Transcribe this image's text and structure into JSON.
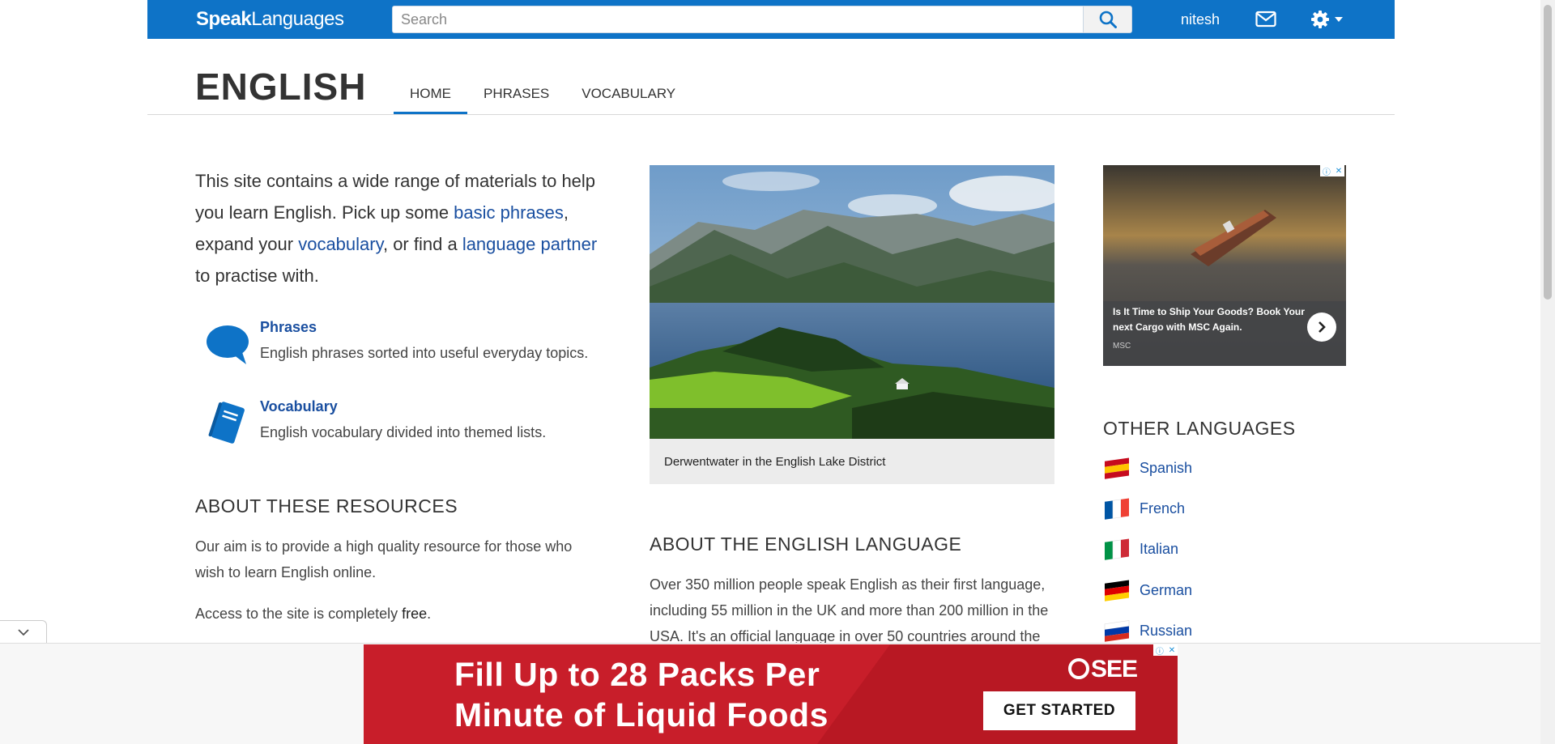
{
  "topbar": {
    "logo_bold": "Speak",
    "logo_light": "Languages",
    "search_placeholder": "Search",
    "username": "nitesh"
  },
  "header": {
    "title": "ENGLISH",
    "tabs": [
      {
        "label": "HOME",
        "active": true
      },
      {
        "label": "PHRASES",
        "active": false
      },
      {
        "label": "VOCABULARY",
        "active": false
      }
    ]
  },
  "intro": {
    "text_1": "This site contains a wide range of materials to help you learn English. Pick up some ",
    "link_1": "basic phrases",
    "text_2": ", expand your ",
    "link_2": "vocabulary",
    "text_3": ", or find a ",
    "link_3": "language partner",
    "text_4": " to practise with."
  },
  "features": [
    {
      "title": "Phrases",
      "desc": "English phrases sorted into useful everyday topics.",
      "icon": "speech-bubble-icon"
    },
    {
      "title": "Vocabulary",
      "desc": "English vocabulary divided into themed lists.",
      "icon": "book-icon"
    }
  ],
  "about_resources": {
    "heading": "ABOUT THESE RESOURCES",
    "para_1": "Our aim is to provide a high quality resource for those who wish to learn English online.",
    "para_2_pre": "Access to the site is completely ",
    "para_2_bold": "free",
    "para_2_post": "."
  },
  "photo": {
    "caption": "Derwentwater in the English Lake District"
  },
  "about_language": {
    "heading": "ABOUT THE ENGLISH LANGUAGE",
    "para": "Over 350 million people speak English as their first language, including 55 million in the UK and more than 200 million in the USA. It's an official language in over 50 countries around the"
  },
  "side_ad": {
    "headline": "Is It Time to Ship Your Goods? Book Your next Cargo with MSC Again.",
    "source": "MSC"
  },
  "other_languages": {
    "heading": "OTHER LANGUAGES",
    "items": [
      {
        "label": "Spanish",
        "colors": [
          "#c60b1e",
          "#ffc400",
          "#c60b1e"
        ]
      },
      {
        "label": "French",
        "colors": [
          "#0055a4",
          "#ffffff",
          "#ef4135"
        ]
      },
      {
        "label": "Italian",
        "colors": [
          "#009246",
          "#ffffff",
          "#ce2b37"
        ]
      },
      {
        "label": "German",
        "colors": [
          "#000000",
          "#dd0000",
          "#ffce00"
        ]
      },
      {
        "label": "Russian",
        "colors": [
          "#ffffff",
          "#0039a6",
          "#d52b1e"
        ]
      }
    ]
  },
  "bottom_ad": {
    "line_1": "Fill Up to 28 Packs Per",
    "line_2": "Minute of Liquid Foods",
    "brand": "SEE",
    "cta": "GET STARTED"
  },
  "colors": {
    "brand_blue": "#0e73c7",
    "link_blue": "#1a4fa0",
    "ad_red": "#c81e2a"
  }
}
